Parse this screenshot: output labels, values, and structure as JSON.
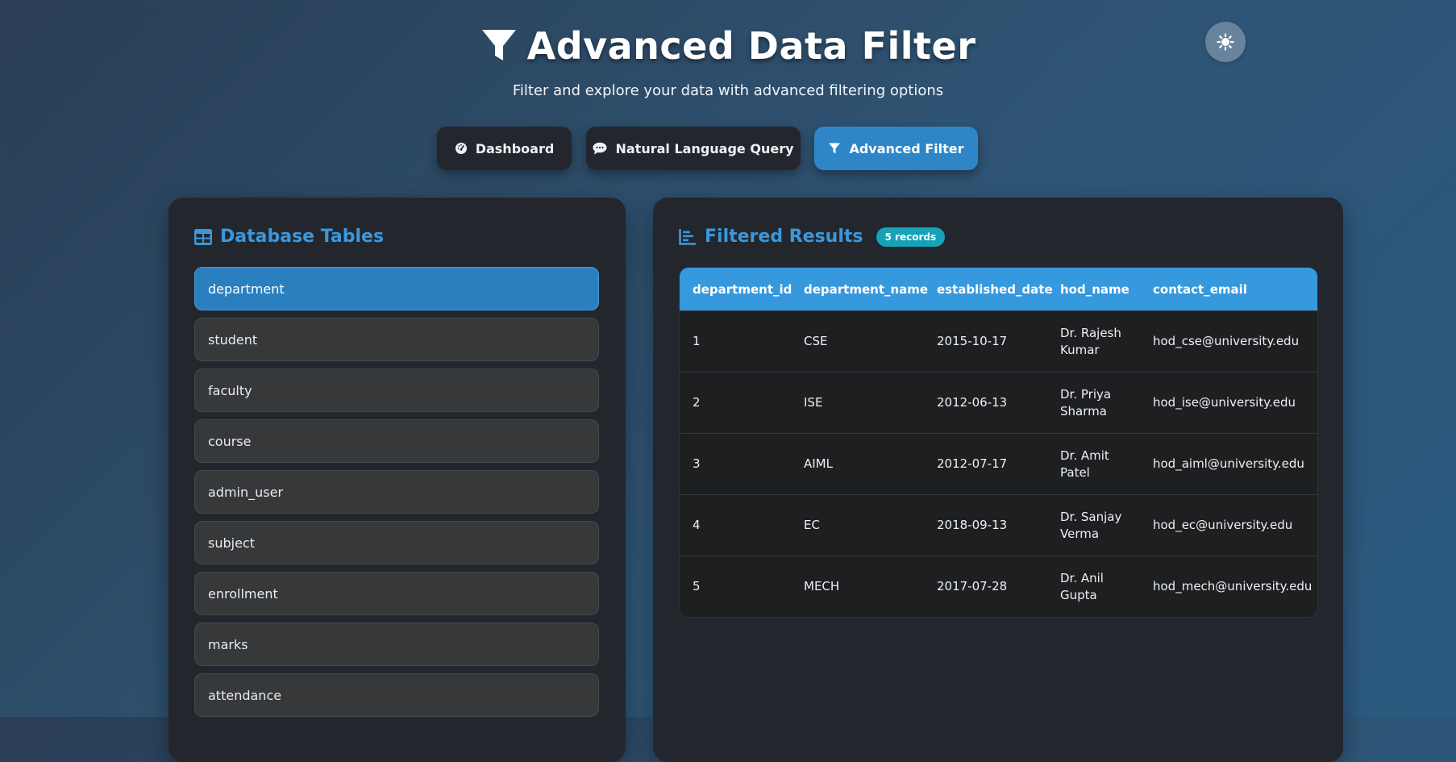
{
  "header": {
    "title": "Advanced Data Filter",
    "subtitle": "Filter and explore your data with advanced filtering options",
    "title_icon": "funnel-icon",
    "theme_icon": "sun-icon"
  },
  "nav": {
    "dashboard": "Dashboard",
    "nlq": "Natural Language Query",
    "advanced": "Advanced Filter",
    "active": "Advanced Filter"
  },
  "tables_panel": {
    "title": "Database Tables",
    "items": [
      "department",
      "student",
      "faculty",
      "course",
      "admin_user",
      "subject",
      "enrollment",
      "marks",
      "attendance"
    ],
    "selected": "department"
  },
  "results": {
    "title": "Filtered Results",
    "badge": "5 records",
    "columns": [
      "department_id",
      "department_name",
      "established_date",
      "hod_name",
      "contact_email"
    ],
    "rows": [
      [
        "1",
        "CSE",
        "2015-10-17",
        "Dr. Rajesh Kumar",
        "hod_cse@university.edu"
      ],
      [
        "2",
        "ISE",
        "2012-06-13",
        "Dr. Priya Sharma",
        "hod_ise@university.edu"
      ],
      [
        "3",
        "AIML",
        "2012-07-17",
        "Dr. Amit Patel",
        "hod_aiml@university.edu"
      ],
      [
        "4",
        "EC",
        "2018-09-13",
        "Dr. Sanjay Verma",
        "hod_ec@university.edu"
      ],
      [
        "5",
        "MECH",
        "2017-07-28",
        "Dr. Anil Gupta",
        "hod_mech@university.edu"
      ]
    ]
  },
  "colors": {
    "accent": "#3a98dc",
    "active_button": "#2e86c8",
    "badge": "#17a2b8",
    "table_header": "#3699de"
  }
}
